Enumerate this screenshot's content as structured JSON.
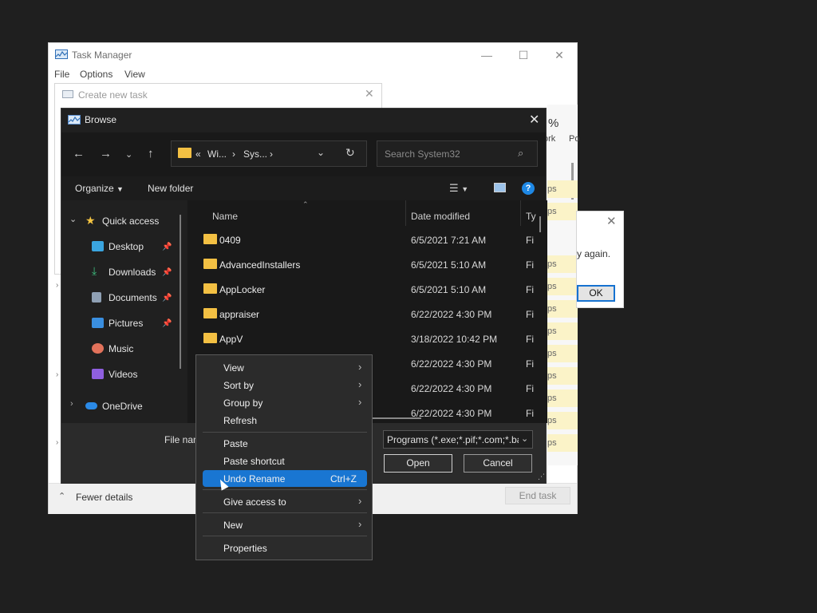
{
  "task_manager": {
    "title": "Task Manager",
    "menu": [
      "File",
      "Options",
      "View"
    ],
    "cpu_percent": "%",
    "col_headers": [
      "ork",
      "Po"
    ],
    "apps_label": "ps",
    "fewer_details": "Fewer details",
    "end_task": "End task"
  },
  "create_task": {
    "title": "Create new task"
  },
  "error_dialog": {
    "message_fragment": "y again.",
    "ok_label": "OK"
  },
  "browse": {
    "title": "Browse",
    "address_crumbs": [
      "«",
      "Wi...",
      "›",
      "Sys...",
      "›"
    ],
    "search_placeholder": "Search System32",
    "organize_label": "Organize",
    "new_folder_label": "New folder",
    "help_label": "?",
    "sidebar": [
      {
        "label": "Quick access",
        "icon": "star-icon",
        "color": "#f5c542",
        "expand": "⌄"
      },
      {
        "label": "Desktop",
        "icon": "desktop-icon",
        "color": "#3aa5e0",
        "pinned": true
      },
      {
        "label": "Downloads",
        "icon": "download-icon",
        "color": "#3fbf7f",
        "pinned": true
      },
      {
        "label": "Documents",
        "icon": "documents-icon",
        "color": "#8fa0b4",
        "pinned": true
      },
      {
        "label": "Pictures",
        "icon": "pictures-icon",
        "color": "#3a8fe0",
        "pinned": true
      },
      {
        "label": "Music",
        "icon": "music-icon",
        "color": "#e2725b",
        "pinned": false
      },
      {
        "label": "Videos",
        "icon": "videos-icon",
        "color": "#8f5fe0",
        "pinned": false
      },
      {
        "label": "OneDrive",
        "icon": "onedrive-icon",
        "color": "#2b8ae6",
        "expand": "›"
      }
    ],
    "columns": {
      "name": "Name",
      "date": "Date modified",
      "type": "Ty"
    },
    "files": [
      {
        "name": "0409",
        "date": "6/5/2021 7:21 AM",
        "type": "Fi"
      },
      {
        "name": "AdvancedInstallers",
        "date": "6/5/2021 5:10 AM",
        "type": "Fi"
      },
      {
        "name": "AppLocker",
        "date": "6/5/2021 5:10 AM",
        "type": "Fi"
      },
      {
        "name": "appraiser",
        "date": "6/22/2022 4:30 PM",
        "type": "Fi"
      },
      {
        "name": "AppV",
        "date": "3/18/2022 10:42 PM",
        "type": "Fi"
      },
      {
        "name": "",
        "date": "6/22/2022 4:30 PM",
        "type": "Fi"
      },
      {
        "name": "",
        "date": "6/22/2022 4:30 PM",
        "type": "Fi"
      },
      {
        "name": "",
        "date": "6/22/2022 4:30 PM",
        "type": "Fi"
      }
    ],
    "file_name_label": "File nan",
    "file_name_value": "",
    "filter_value": "Programs (*.exe;*.pif;*.com;*.ba",
    "open_label": "Open",
    "cancel_label": "Cancel"
  },
  "context_menu": {
    "items": [
      {
        "label": "View",
        "submenu": true
      },
      {
        "label": "Sort by",
        "submenu": true
      },
      {
        "label": "Group by",
        "submenu": true
      },
      {
        "label": "Refresh"
      },
      {
        "label": "Paste"
      },
      {
        "label": "Paste shortcut"
      },
      {
        "label": "Undo Rename",
        "shortcut": "Ctrl+Z",
        "highlighted": true
      },
      {
        "label": "Give access to",
        "submenu": true
      },
      {
        "label": "New",
        "submenu": true
      },
      {
        "label": "Properties"
      }
    ]
  }
}
